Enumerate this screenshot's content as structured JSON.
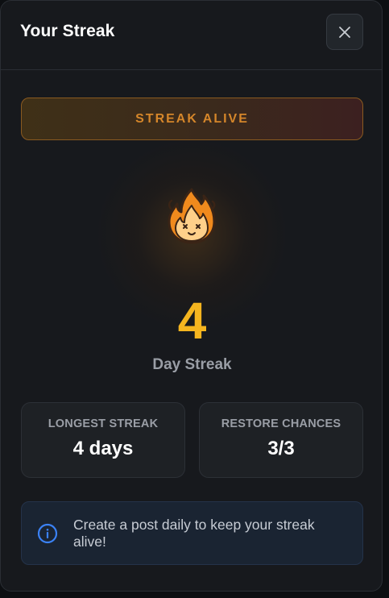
{
  "header": {
    "title": "Your Streak",
    "close_icon": "close-icon"
  },
  "status": {
    "banner_label": "STREAK ALIVE",
    "accent_color": "#d5862a",
    "icon": "fire-icon"
  },
  "streak": {
    "count": "4",
    "label": "Day Streak",
    "count_color": "#f5b51f"
  },
  "stats": [
    {
      "label": "LONGEST STREAK",
      "value": "4 days"
    },
    {
      "label": "RESTORE CHANCES",
      "value": "3/3"
    }
  ],
  "info": {
    "icon": "info-icon",
    "text": "Create a post daily to keep your streak alive!"
  }
}
